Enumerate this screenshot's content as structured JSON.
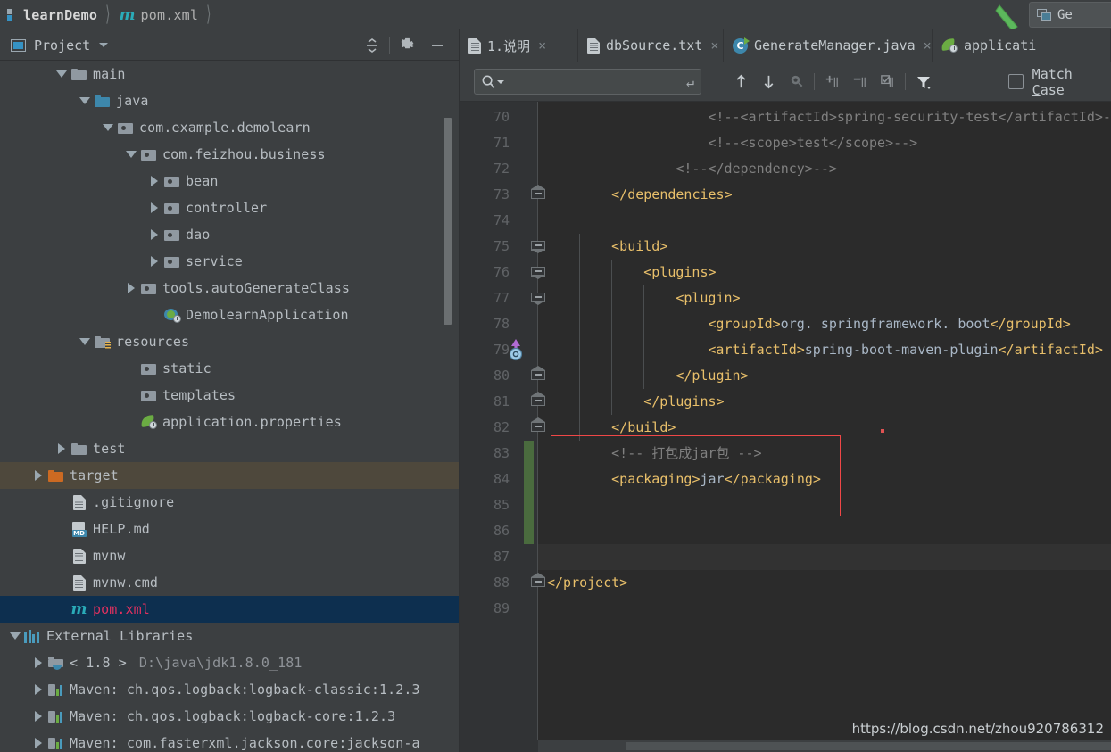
{
  "window": {
    "breadcrumb": [
      {
        "label": "learnDemo",
        "icon": "module-icon"
      },
      {
        "label": "pom.xml",
        "icon": "maven-m-icon"
      }
    ],
    "tool_window_tab": {
      "label": "Ge",
      "icon": "window-icon"
    }
  },
  "project_panel": {
    "title": "Project",
    "icons": {
      "collapse": "collapse-all-icon",
      "settings": "gear-icon",
      "hide": "minimize-icon"
    },
    "tree": [
      {
        "label": "main",
        "indent": 2,
        "arrow": "down",
        "icon": "folder-grey",
        "state": "normal"
      },
      {
        "label": "java",
        "indent": 3,
        "arrow": "down",
        "icon": "folder-blue",
        "state": "normal"
      },
      {
        "label": "com.example.demolearn",
        "indent": 4,
        "arrow": "down",
        "icon": "package",
        "state": "normal"
      },
      {
        "label": "com.feizhou.business",
        "indent": 5,
        "arrow": "down",
        "icon": "package",
        "state": "normal"
      },
      {
        "label": "bean",
        "indent": 6,
        "arrow": "right",
        "icon": "package",
        "state": "normal"
      },
      {
        "label": "controller",
        "indent": 6,
        "arrow": "right",
        "icon": "package",
        "state": "normal"
      },
      {
        "label": "dao",
        "indent": 6,
        "arrow": "right",
        "icon": "package",
        "state": "normal"
      },
      {
        "label": "service",
        "indent": 6,
        "arrow": "right",
        "icon": "package",
        "state": "normal"
      },
      {
        "label": "tools.autoGenerateClass",
        "indent": 5,
        "arrow": "right",
        "icon": "package",
        "state": "normal"
      },
      {
        "label": "DemolearnApplication",
        "indent": 6,
        "arrow": "none",
        "icon": "spring-run",
        "state": "normal"
      },
      {
        "label": "resources",
        "indent": 3,
        "arrow": "down",
        "icon": "folder-res",
        "state": "normal"
      },
      {
        "label": "static",
        "indent": 5,
        "arrow": "none",
        "icon": "package",
        "state": "normal"
      },
      {
        "label": "templates",
        "indent": 5,
        "arrow": "none",
        "icon": "package",
        "state": "normal"
      },
      {
        "label": "application.properties",
        "indent": 5,
        "arrow": "none",
        "icon": "spring-leaf",
        "state": "normal"
      },
      {
        "label": "test",
        "indent": 2,
        "arrow": "right",
        "icon": "folder-grey",
        "state": "normal"
      },
      {
        "label": "target",
        "indent": 1,
        "arrow": "right",
        "icon": "folder-orange",
        "state": "hover"
      },
      {
        "label": ".gitignore",
        "indent": 2,
        "arrow": "none",
        "icon": "text-file",
        "state": "normal"
      },
      {
        "label": "HELP.md",
        "indent": 2,
        "arrow": "none",
        "icon": "md-file",
        "state": "normal"
      },
      {
        "label": "mvnw",
        "indent": 2,
        "arrow": "none",
        "icon": "text-file",
        "state": "normal"
      },
      {
        "label": "mvnw.cmd",
        "indent": 2,
        "arrow": "none",
        "icon": "text-file",
        "state": "normal"
      },
      {
        "label": "pom.xml",
        "indent": 2,
        "arrow": "none",
        "icon": "maven-m",
        "state": "selected"
      },
      {
        "label": "External Libraries",
        "indent": 0,
        "arrow": "down",
        "icon": "libraries",
        "state": "normal"
      },
      {
        "label": "< 1.8 >",
        "suffix": "D:\\java\\jdk1.8.0_181",
        "indent": 1,
        "arrow": "right",
        "icon": "jdk-folder",
        "state": "normal"
      },
      {
        "label": "Maven: ch.qos.logback:logback-classic:1.2.3",
        "indent": 1,
        "arrow": "right",
        "icon": "maven-lib",
        "state": "normal"
      },
      {
        "label": "Maven: ch.qos.logback:logback-core:1.2.3",
        "indent": 1,
        "arrow": "right",
        "icon": "maven-lib",
        "state": "normal"
      },
      {
        "label": "Maven: com.fasterxml.jackson.core:jackson-a",
        "indent": 1,
        "arrow": "right",
        "icon": "maven-lib",
        "state": "normal"
      }
    ]
  },
  "editor": {
    "tabs": [
      {
        "label": "1.说明",
        "icon": "text-file-icon",
        "closable": true,
        "active": false
      },
      {
        "label": "dbSource.txt",
        "icon": "text-file-icon",
        "closable": true,
        "active": false
      },
      {
        "label": "GenerateManager.java",
        "icon": "java-class-icon",
        "closable": true,
        "active": false
      },
      {
        "label": "applicati",
        "icon": "spring-leaf-icon",
        "closable": false,
        "active": false
      }
    ],
    "find_toolbar": {
      "search_value": "",
      "search_placeholder": "",
      "icons": [
        "search-icon",
        "enter-icon",
        "find-previous-icon",
        "find-next-icon",
        "select-all-occurrences-icon",
        "add-occurrence-icon",
        "remove-occurrence-icon",
        "select-occurrences-icon",
        "filter-icon"
      ],
      "match_case_label": "Match Case",
      "match_case_checked": false
    },
    "first_line_number": 70,
    "lines": [
      {
        "n": 70,
        "indent": 20,
        "tokens": [
          {
            "t": "<!--<artifactId>spring-security-test</artifactId>-->",
            "c": "comment"
          }
        ]
      },
      {
        "n": 71,
        "indent": 20,
        "tokens": [
          {
            "t": "<!--<scope>test</scope>-->",
            "c": "comment"
          }
        ]
      },
      {
        "n": 72,
        "indent": 16,
        "tokens": [
          {
            "t": "<!--</dependency>-->",
            "c": "comment"
          }
        ]
      },
      {
        "n": 73,
        "indent": 8,
        "tokens": [
          {
            "t": "</dependencies>",
            "c": "tag"
          }
        ]
      },
      {
        "n": 74,
        "indent": 0,
        "tokens": []
      },
      {
        "n": 75,
        "indent": 8,
        "tokens": [
          {
            "t": "<build>",
            "c": "tag"
          }
        ]
      },
      {
        "n": 76,
        "indent": 12,
        "tokens": [
          {
            "t": "<plugins>",
            "c": "tag"
          }
        ]
      },
      {
        "n": 77,
        "indent": 16,
        "tokens": [
          {
            "t": "<plugin>",
            "c": "tag"
          }
        ]
      },
      {
        "n": 78,
        "indent": 20,
        "tokens": [
          {
            "t": "<groupId>",
            "c": "tag"
          },
          {
            "t": "org. springframework. boot",
            "c": "text"
          },
          {
            "t": "</groupId>",
            "c": "tag"
          }
        ]
      },
      {
        "n": 79,
        "indent": 20,
        "tokens": [
          {
            "t": "<artifactId>",
            "c": "tag"
          },
          {
            "t": "spring-boot-maven-plugin",
            "c": "text"
          },
          {
            "t": "</artifactId>",
            "c": "tag"
          }
        ]
      },
      {
        "n": 80,
        "indent": 16,
        "tokens": [
          {
            "t": "</plugin>",
            "c": "tag"
          }
        ]
      },
      {
        "n": 81,
        "indent": 12,
        "tokens": [
          {
            "t": "</plugins>",
            "c": "tag"
          }
        ]
      },
      {
        "n": 82,
        "indent": 8,
        "tokens": [
          {
            "t": "</build>",
            "c": "tag"
          }
        ]
      },
      {
        "n": 83,
        "indent": 8,
        "tokens": [
          {
            "t": "<!-- 打包成jar包 -->",
            "c": "comment"
          }
        ]
      },
      {
        "n": 84,
        "indent": 8,
        "tokens": [
          {
            "t": "<packaging>",
            "c": "tag"
          },
          {
            "t": "jar",
            "c": "text"
          },
          {
            "t": "</packaging>",
            "c": "tag"
          }
        ]
      },
      {
        "n": 85,
        "indent": 0,
        "tokens": []
      },
      {
        "n": 86,
        "indent": 0,
        "tokens": []
      },
      {
        "n": 87,
        "indent": 0,
        "tokens": [],
        "caret": true
      },
      {
        "n": 88,
        "indent": 0,
        "tokens": [
          {
            "t": "</project>",
            "c": "tag"
          }
        ]
      },
      {
        "n": 89,
        "indent": 0,
        "tokens": []
      }
    ],
    "fold_markers": [
      {
        "line": 73,
        "dir": "up"
      },
      {
        "line": 75,
        "dir": "dn"
      },
      {
        "line": 76,
        "dir": "dn"
      },
      {
        "line": 77,
        "dir": "dn"
      },
      {
        "line": 80,
        "dir": "up"
      },
      {
        "line": 81,
        "dir": "up"
      },
      {
        "line": 82,
        "dir": "up"
      },
      {
        "line": 88,
        "dir": "up"
      }
    ],
    "gutter_icons": [
      {
        "line": 79,
        "icon": "recursive-call-arrow-icon"
      }
    ],
    "change_bar": {
      "from_line": 83,
      "to_line": 86,
      "color": "#4a6b3e"
    },
    "annotation_box": {
      "from_line": 83,
      "to_line": 85,
      "color": "#f04747"
    },
    "watermark": "https://blog.csdn.net/zhou920786312"
  },
  "colors": {
    "background": "#2b2b2b",
    "panel": "#3c3f41",
    "gutter": "#313335",
    "accent_blue": "#3592c4",
    "tag": "#e8bf6a",
    "comment": "#808080",
    "text": "#a9b7c6",
    "selection": "#0d2f4f",
    "selection_text": "#e0315f",
    "hover": "#4e483c",
    "annotation_red": "#f04747",
    "change_green": "#4a6b3e"
  }
}
